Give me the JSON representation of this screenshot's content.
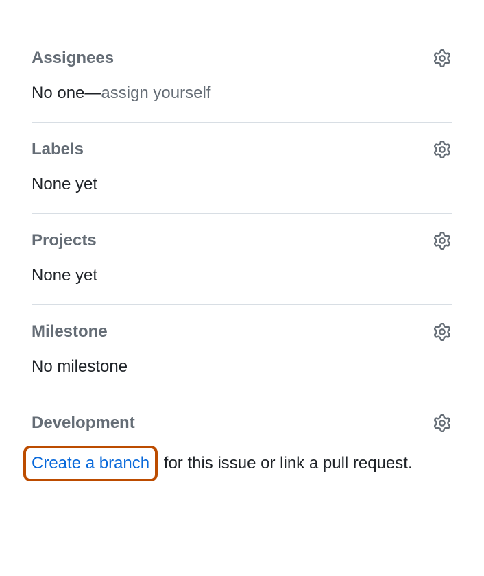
{
  "assignees": {
    "title": "Assignees",
    "empty_prefix": "No one—",
    "assign_self": "assign yourself"
  },
  "labels": {
    "title": "Labels",
    "empty": "None yet"
  },
  "projects": {
    "title": "Projects",
    "empty": "None yet"
  },
  "milestone": {
    "title": "Milestone",
    "empty": "No milestone"
  },
  "development": {
    "title": "Development",
    "create_branch": "Create a branch",
    "suffix": " for this issue or link a pull request."
  }
}
